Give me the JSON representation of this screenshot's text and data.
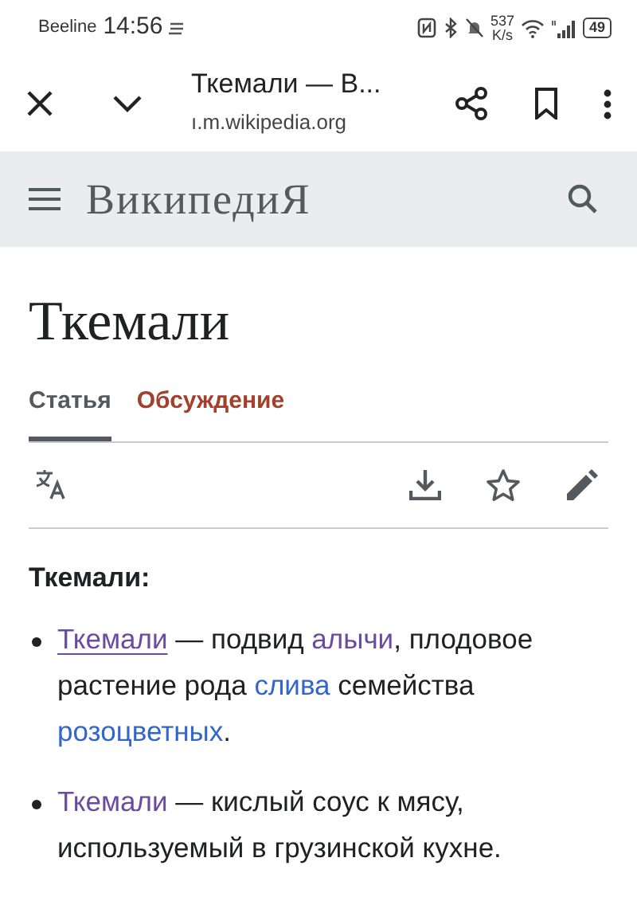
{
  "status_bar": {
    "carrier": "Beeline",
    "time": "14:56",
    "speed": "537",
    "speed_unit": "K/s",
    "battery": "49"
  },
  "browser_toolbar": {
    "page_title": "Ткемали — В...",
    "url": "ı.m.wikipedia.org"
  },
  "wiki_header": {
    "wordmark": "ВикипедиЯ"
  },
  "article": {
    "title": "Ткемали",
    "tabs": [
      {
        "label": "Статья",
        "selected": true
      },
      {
        "label": "Обсуждение",
        "selected": false
      }
    ],
    "intro": "Ткемали:",
    "items": [
      {
        "parts": [
          {
            "kind": "link",
            "text": "Ткемали",
            "visited": true,
            "focused": true
          },
          {
            "kind": "text",
            "text": " — подвид "
          },
          {
            "kind": "link",
            "text": "алычи",
            "visited": true,
            "focused": false
          },
          {
            "kind": "text",
            "text": ", плодовое растение рода "
          },
          {
            "kind": "link",
            "text": "слива",
            "visited": false,
            "focused": false
          },
          {
            "kind": "text",
            "text": " семейства "
          },
          {
            "kind": "link",
            "text": "розоцветных",
            "visited": false,
            "focused": false
          },
          {
            "kind": "text",
            "text": "."
          }
        ]
      },
      {
        "parts": [
          {
            "kind": "link",
            "text": "Ткемали",
            "visited": true,
            "focused": false
          },
          {
            "kind": "text",
            "text": " — кислый соус к мясу, используемый в грузинской кухне."
          }
        ]
      }
    ]
  }
}
